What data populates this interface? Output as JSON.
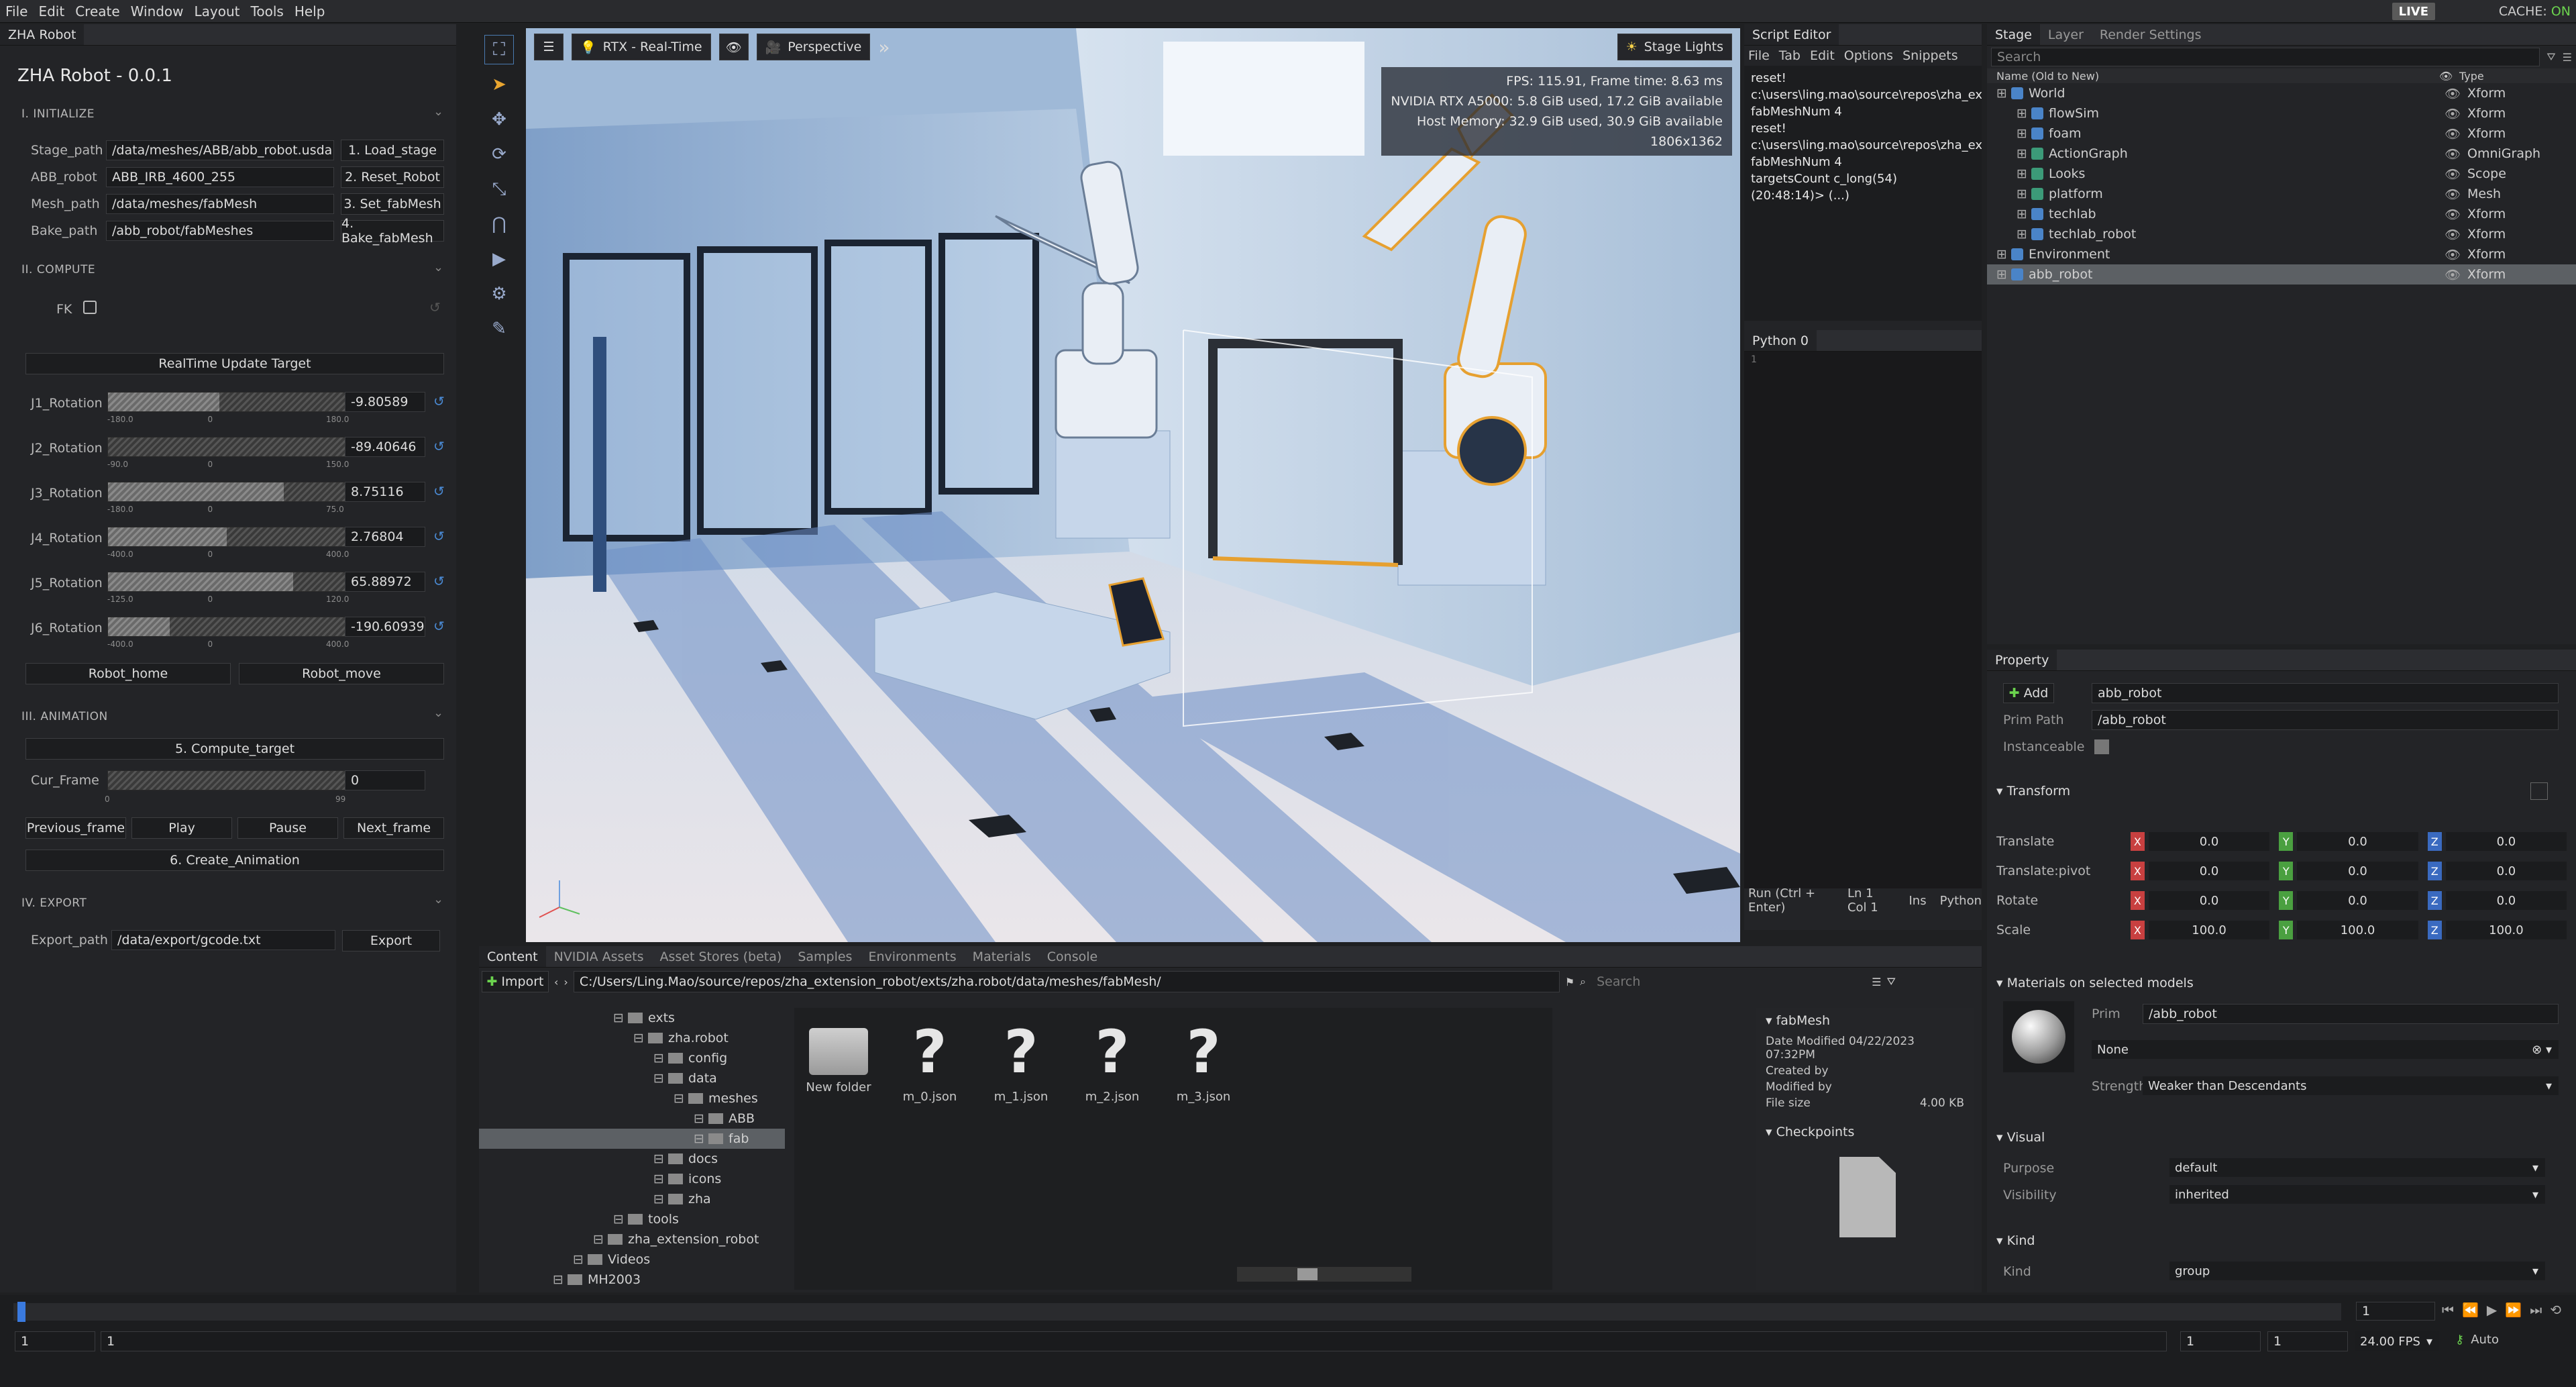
{
  "menu": {
    "items": [
      "File",
      "Edit",
      "Create",
      "Window",
      "Layout",
      "Tools",
      "Help"
    ],
    "live": "LIVE",
    "cache_label": "CACHE:",
    "cache_state": "ON"
  },
  "left": {
    "tab": "ZHA Robot",
    "title": "ZHA Robot - 0.0.1",
    "s1": "I. INITIALIZE",
    "paths": [
      {
        "label": "Stage_path",
        "value": "/data/meshes/ABB/abb_robot.usda",
        "btn": "1. Load_stage"
      },
      {
        "label": "ABB_robot",
        "value": "ABB_IRB_4600_255",
        "btn": "2. Reset_Robot"
      },
      {
        "label": "Mesh_path",
        "value": "/data/meshes/fabMesh",
        "btn": "3. Set_fabMesh"
      },
      {
        "label": "Bake_path",
        "value": "/abb_robot/fabMeshes",
        "btn": "4. Bake_fabMesh"
      }
    ],
    "s2": "II. COMPUTE",
    "fk": "FK",
    "rt": "RealTime Update Target",
    "joints": [
      {
        "label": "J1_Rotation",
        "value": "-9.80589",
        "min": "-180.0",
        "mid": "0",
        "max": "180.0",
        "fill": 0.47
      },
      {
        "label": "J2_Rotation",
        "value": "-89.40646",
        "min": "-90.0",
        "mid": "0",
        "max": "150.0",
        "fill": 0.0
      },
      {
        "label": "J3_Rotation",
        "value": "8.75116",
        "min": "-180.0",
        "mid": "0",
        "max": "75.0",
        "fill": 0.74
      },
      {
        "label": "J4_Rotation",
        "value": "2.76804",
        "min": "-400.0",
        "mid": "0",
        "max": "400.0",
        "fill": 0.5
      },
      {
        "label": "J5_Rotation",
        "value": "65.88972",
        "min": "-125.0",
        "mid": "0",
        "max": "120.0",
        "fill": 0.78
      },
      {
        "label": "J6_Rotation",
        "value": "-190.60939",
        "min": "-400.0",
        "mid": "0",
        "max": "400.0",
        "fill": 0.26
      }
    ],
    "home": "Robot_home",
    "move": "Robot_move",
    "s3": "III. ANIMATION",
    "compute": "5. Compute_target",
    "cur_frame": {
      "label": "Cur_Frame",
      "value": "0",
      "min": "0",
      "max": "99"
    },
    "anim": [
      "Previous_frame",
      "Play",
      "Pause",
      "Next_frame"
    ],
    "create": "6. Create_Animation",
    "s4": "IV. EXPORT",
    "export_label": "Export_path",
    "export_value": "/data/export/gcode.txt",
    "export_btn": "Export"
  },
  "viewport": {
    "rtx": "RTX - Real-Time",
    "persp": "Perspective",
    "lights": "Stage Lights",
    "stats": [
      "FPS: 115.91, Frame time: 8.63 ms",
      "NVIDIA RTX A5000: 5.8 GiB used, 17.2 GiB available",
      "Host Memory: 32.9 GiB used, 30.9 GiB available",
      "1806x1362"
    ]
  },
  "script": {
    "tab": "Script Editor",
    "menu": [
      "File",
      "Tab",
      "Edit",
      "Options",
      "Snippets"
    ],
    "log": [
      "reset!",
      "c:\\users\\ling.mao\\source\\repos\\zha_ext",
      "fabMeshNum 4",
      "reset!",
      "c:\\users\\ling.mao\\source\\repos\\zha_ext",
      "fabMeshNum 4",
      "targetsCount c_long(54)",
      "(20:48:14)> (...)"
    ],
    "python_tab": "Python 0",
    "line": "1",
    "run": "Run (Ctrl + Enter)",
    "ln": "Ln 1 Col 1",
    "ins": "Ins",
    "lang": "Python"
  },
  "stage": {
    "tabs": [
      "Stage",
      "Layer",
      "Render Settings"
    ],
    "search": "Search",
    "col_name": "Name (Old to New)",
    "col_type": "Type",
    "rows": [
      {
        "name": "World",
        "type": "Xform",
        "indent": 0
      },
      {
        "name": "flowSim",
        "type": "Xform",
        "indent": 1
      },
      {
        "name": "foam",
        "type": "Xform",
        "indent": 1
      },
      {
        "name": "ActionGraph",
        "type": "OmniGraph",
        "indent": 1
      },
      {
        "name": "Looks",
        "type": "Scope",
        "indent": 1
      },
      {
        "name": "platform",
        "type": "Mesh",
        "indent": 1
      },
      {
        "name": "techlab",
        "type": "Xform",
        "indent": 1
      },
      {
        "name": "techlab_robot",
        "type": "Xform",
        "indent": 1
      },
      {
        "name": "Environment",
        "type": "Xform",
        "indent": 0
      },
      {
        "name": "abb_robot",
        "type": "Xform",
        "indent": 0
      }
    ]
  },
  "property": {
    "tab": "Property",
    "add": "Add",
    "name": "abb_robot",
    "prim_path_label": "Prim Path",
    "prim_path": "/abb_robot",
    "instanceable": "Instanceable",
    "transform": "Transform",
    "rows": [
      {
        "label": "Translate",
        "x": "0.0",
        "y": "0.0",
        "z": "0.0"
      },
      {
        "label": "Translate:pivot",
        "x": "0.0",
        "y": "0.0",
        "z": "0.0"
      },
      {
        "label": "Rotate",
        "x": "0.0",
        "y": "0.0",
        "z": "0.0"
      },
      {
        "label": "Scale",
        "x": "100.0",
        "y": "100.0",
        "z": "100.0"
      }
    ],
    "materials": "Materials on selected models",
    "prim_label": "Prim",
    "prim_value": "/abb_robot",
    "mat_value": "None",
    "strength_label": "Strength",
    "strength_value": "Weaker than Descendants",
    "visual": "Visual",
    "purpose_label": "Purpose",
    "purpose_value": "default",
    "visibility_label": "Visibility",
    "visibility_value": "inherited",
    "kind_hdr": "Kind",
    "kind_label": "Kind",
    "kind_value": "group"
  },
  "content": {
    "tabs": [
      "Content",
      "NVIDIA Assets",
      "Asset Stores (beta)",
      "Samples",
      "Environments",
      "Materials",
      "Console"
    ],
    "import": "Import",
    "path": "C:/Users/Ling.Mao/source/repos/zha_extension_robot/exts/zha.robot/data/meshes/fabMesh/",
    "search": "Search",
    "tree": [
      {
        "name": "exts",
        "lvl": 4
      },
      {
        "name": "zha.robot",
        "lvl": 5
      },
      {
        "name": "config",
        "lvl": 6
      },
      {
        "name": "data",
        "lvl": 6
      },
      {
        "name": "meshes",
        "lvl": 7
      },
      {
        "name": "ABB",
        "lvl": 8
      },
      {
        "name": "fab",
        "lvl": 8
      },
      {
        "name": "docs",
        "lvl": 6
      },
      {
        "name": "icons",
        "lvl": 6
      },
      {
        "name": "zha",
        "lvl": 6
      },
      {
        "name": "tools",
        "lvl": 4
      },
      {
        "name": "zha_extension_robot",
        "lvl": 3
      },
      {
        "name": "Videos",
        "lvl": 2
      },
      {
        "name": "MH2003",
        "lvl": 1
      }
    ],
    "files": [
      "New folder",
      "m_0.json",
      "m_1.json",
      "m_2.json",
      "m_3.json"
    ],
    "info_title": "fabMesh",
    "date": "Date Modified 04/22/2023 07:32PM",
    "created": "Created by",
    "modified": "Modified by",
    "size_label": "File size",
    "size": "4.00 KB",
    "checkpoints": "Checkpoints"
  },
  "timeline": {
    "start": "1",
    "cur": "1",
    "end1": "1",
    "end2": "1",
    "frame": "1",
    "fps": "24.00 FPS",
    "auto": "Auto"
  }
}
